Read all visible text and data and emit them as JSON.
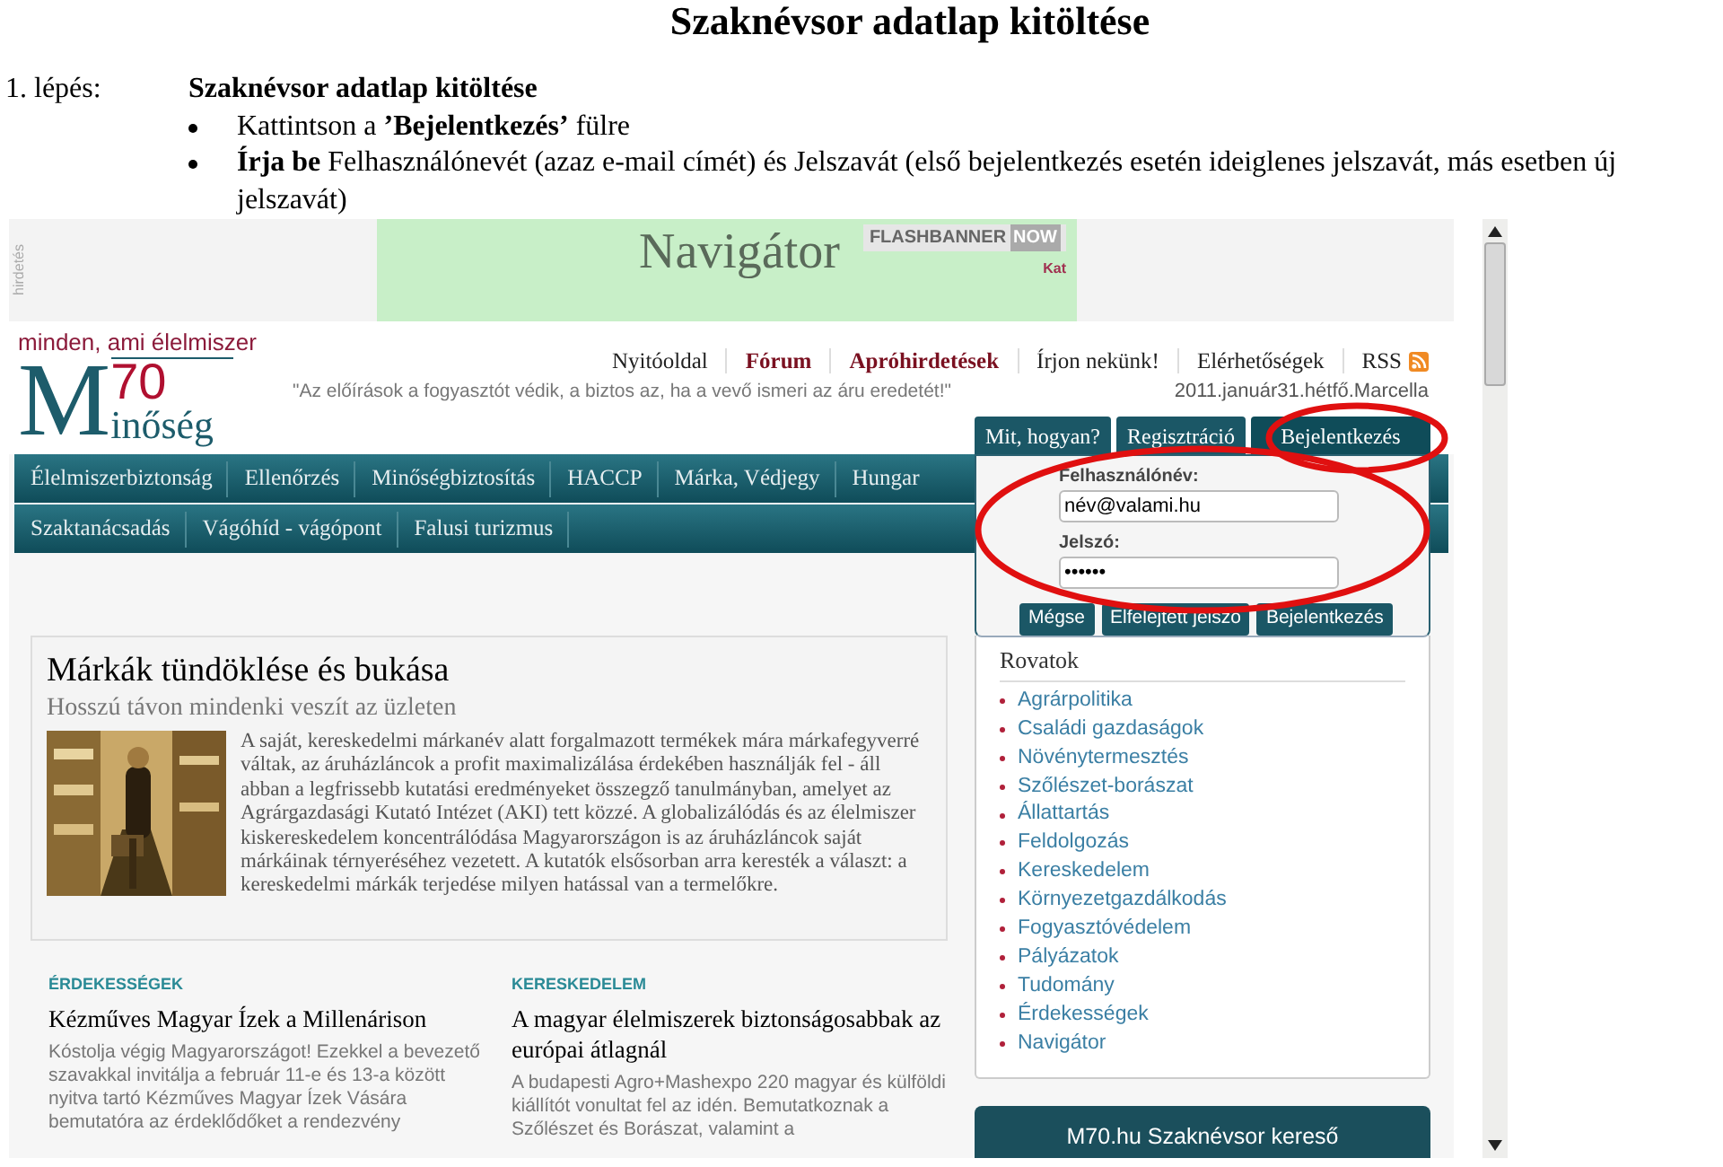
{
  "document": {
    "title": "Szaknévsor adatlap kitöltése",
    "step_label": "1. lépés:",
    "step_title": "Szaknévsor adatlap kitöltése",
    "bullets": [
      "Kattintson a **’Bejelentkezés’** fülre",
      "**Írja be** Felhasználónevét (azaz e-mail címét) és Jelszavát (első bejelentkezés esetén ideiglenes jelszavát, más esetben új jelszavát)"
    ]
  },
  "banner": {
    "side_label": "hirdetés",
    "title": "Navigátor",
    "badge": "FLASHBANNER",
    "badge_extra": "NOW",
    "corner_text": "Kat"
  },
  "site": {
    "tagline": "minden, ami élelmiszer",
    "logo_letter": "M",
    "logo_number": "70",
    "logo_rest": "inőség",
    "top_links": [
      {
        "label": "Nyitóoldal",
        "highlight": false
      },
      {
        "label": "Fórum",
        "highlight": true
      },
      {
        "label": "Apróhirdetések",
        "highlight": true
      },
      {
        "label": "Írjon nekünk!",
        "highlight": false
      },
      {
        "label": "Elérhetőségek",
        "highlight": false
      },
      {
        "label": "RSS",
        "highlight": false
      }
    ],
    "quote": "\"Az előírások a fogyasztót védik, a biztos az, ha a vevő ismeri az áru eredetét!\"",
    "date": "2011.január31.hétfő.Marcella"
  },
  "nav_rows": [
    [
      "Élelmiszerbiztonság",
      "Ellenőrzés",
      "Minőségbiztosítás",
      "HACCP",
      "Márka, Védjegy",
      "Hungar"
    ],
    [
      "Szaktanácsadás",
      "Vágóhíd - vágópont",
      "Falusi turizmus"
    ]
  ],
  "login": {
    "tabs": [
      {
        "label": "Mit, hogyan?",
        "selected": false
      },
      {
        "label": "Regisztráció",
        "selected": false
      },
      {
        "label": "Bejelentkezés",
        "selected": true
      }
    ],
    "username_label": "Felhasználónév:",
    "username": "név@valami.hu",
    "password_label": "Jelszó:",
    "password": "••••••",
    "buttons": [
      "Mégse",
      "Elfelejtett jelszó",
      "Bejelentkezés"
    ]
  },
  "article": {
    "title": "Márkák tündöklése és bukása",
    "subtitle": "Hosszú távon mindenki veszít az üzleten",
    "body": "A saját, kereskedelmi márkanév alatt forgalmazott termékek mára márkafegyverré váltak, az áruházláncok a profit maximalizálása érdekében használják fel - áll abban a legfrissebb kutatási eredményeket összegző tanulmányban, amelyet az Agrárgazdasági Kutató Intézet (AKI) tett közzé. A globalizálódás és az élelmiszer kiskereskedelem koncentrálódása Magyarországon is az áruházláncok saját márkáinak térnyeréséhez vezetett. A kutatók elsősorban arra keresték a választ: a kereskedelmi márkák terjedése milyen hatással van a termelőkre."
  },
  "teasers": [
    {
      "category": "ÉRDEKESSÉGEK",
      "title": "Kézműves Magyar Ízek a Millenárison",
      "body": "Kóstolja végig Magyarországot! Ezekkel a bevezető szavakkal invitálja a február 11-e és 13-a között nyitva tartó Kézműves Magyar Ízek Vására bemutatóra az érdeklődőket a rendezvény"
    },
    {
      "category": "KERESKEDELEM",
      "title": "A magyar élelmiszerek biztonságosabbak az európai átlagnál",
      "body": "A budapesti Agro+Mashexpo 220 magyar és külföldi kiállítót vonultat fel az idén. Bemutatkoznak a Szőlészet és Borászat, valamint a"
    }
  ],
  "sidebar": {
    "title": "Rovatok",
    "items": [
      "Agrárpolitika",
      "Családi gazdaságok",
      "Növénytermesztés",
      "Szőlészet-borászat",
      "Állattartás",
      "Feldolgozás",
      "Kereskedelem",
      "Környezetgazdálkodás",
      "Fogyasztóvédelem",
      "Pályázatok",
      "Tudomány",
      "Érdekességek",
      "Navigátor"
    ]
  },
  "search_box": {
    "title": "M70.hu Szaknévsor kereső"
  }
}
